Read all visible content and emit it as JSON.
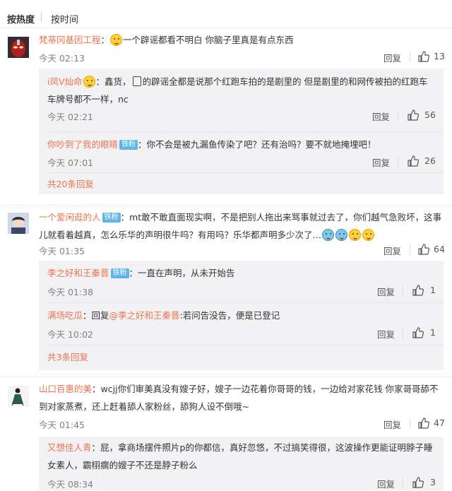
{
  "sort": {
    "hot": "按热度",
    "time": "按时间"
  },
  "labels": {
    "reply": "回复"
  },
  "comments": [
    {
      "name": "梵蒂冈基因工程",
      "text": "一个辟谣都看不明白 你脑子里真是有点东西",
      "time": "今天 02:13",
      "likes": "13",
      "avatar_icon": "superhero-avatar",
      "emoji_icon": "thinking-emoji",
      "replies": [
        {
          "name": "i凤V灿命",
          "text": "鑫货，",
          "text2": "的辟谣全都是说那个红跑车拍的是剧里的 但是剧里的和网传被拍的红跑车车牌号都不一样，nc",
          "time": "今天 02:21",
          "likes": "56",
          "icons": [
            "crown-emoji-icon",
            "gesture-icon"
          ]
        },
        {
          "name": "你吵到了我的眼睛",
          "badge": "铁粉",
          "text": "你不会是被九漏鱼传染了吧？还有治吗？要不就地掩埋吧！",
          "time": "今天 07:01",
          "likes": "26"
        }
      ],
      "more": "共20条回复"
    },
    {
      "name": "一个爱闲逛的人",
      "badge": "铁粉",
      "text": "mt敢不敢直面现实啊，不是把别人拖出来骂事就过去了，你们越气急败坏，这事儿就看着越真，怎么乐华的声明很牛吗？有用吗？乐华都声明多少次了…",
      "time": "今天 01:35",
      "likes": "64",
      "avatar_icon": "anime-avatar",
      "emoji_icons": [
        "cry-emoji-icon",
        "cry-emoji-icon",
        "sleepy-emoji-icon",
        "grimace-emoji-icon"
      ],
      "replies": [
        {
          "name": "李之好和王秦晋",
          "badge": "铁粉",
          "text": "一直在声明，从未开始告",
          "time": "今天 01:38",
          "likes": "1"
        },
        {
          "name": "满场吃瓜",
          "text_prefix": "回复",
          "mention": "@李之好和王秦晋",
          "text": ":若问告没告，便是已登记",
          "time": "今天 10:02",
          "likes": "1"
        }
      ],
      "more": "共3条回复"
    },
    {
      "name": "山口百惠的美",
      "text": "wcjj你们审美真没有嫂子好，嫂子一边花着你哥哥的钱，一边给对家花钱 你家哥哥舔不到对家蒸煮，还上赶着舔人家粉丝，舔狗人设不倒哦~",
      "time": "今天 01:45",
      "likes": "47",
      "avatar_icon": "sketch-figure-avatar",
      "replies": [
        {
          "name": "又想佳人青",
          "text": "屁，拿商场摆件照片p的你都信，真好忽悠，不过搞笑得很，这波操作更能证明脖子睡女素人，霸栩瘸的嫂子不还是脖子粉么",
          "time": "今天 08:34",
          "likes": "3"
        }
      ]
    }
  ],
  "colors": {
    "name": "#eb7350",
    "reply_bg": "#f2f2f5",
    "badge": "#5eb6e8"
  }
}
